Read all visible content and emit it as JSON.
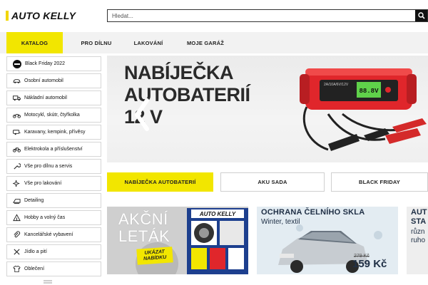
{
  "header": {
    "logo_text": "AUTO KELLY",
    "search_placeholder": "Hledat..."
  },
  "nav": {
    "items": [
      {
        "label": "KATALOG",
        "active": true
      },
      {
        "label": "PRO DÍLNU",
        "active": false
      },
      {
        "label": "LAKOVÁNÍ",
        "active": false
      },
      {
        "label": "MOJE GARÁŽ",
        "active": false
      }
    ]
  },
  "sidebar": {
    "items": [
      {
        "label": "Black Friday 2022",
        "icon": "black-friday-badge-icon"
      },
      {
        "label": "Osobní automobil",
        "icon": "car-icon"
      },
      {
        "label": "Nákladní automobil",
        "icon": "truck-icon"
      },
      {
        "label": "Motocykl, skútr, čtyřkolka",
        "icon": "motorcycle-icon"
      },
      {
        "label": "Karavany, kempink, přívěsy",
        "icon": "caravan-icon"
      },
      {
        "label": "Elektrokola a příslušenství",
        "icon": "ebike-icon"
      },
      {
        "label": "Vše pro dílnu a servis",
        "icon": "wrench-icon"
      },
      {
        "label": "Vše pro lakování",
        "icon": "sparkle-icon"
      },
      {
        "label": "Detailing",
        "icon": "detailing-icon"
      },
      {
        "label": "Hobby a volný čas",
        "icon": "tent-icon"
      },
      {
        "label": "Kancelářské vybavení",
        "icon": "paperclip-icon"
      },
      {
        "label": "Jídlo a pití",
        "icon": "cutlery-icon"
      },
      {
        "label": "Oblečení",
        "icon": "tshirt-icon"
      }
    ]
  },
  "banner": {
    "title": "NABÍJEČKA\nAUTOBATERIÍ\n12 V",
    "charger_display": "88.8V",
    "charger_brand": "2A/10A/6V/12V"
  },
  "banner_tabs": [
    {
      "label": "NABÍJEČKA AUTOBATERIÍ",
      "active": true
    },
    {
      "label": "AKU SADA",
      "active": false
    },
    {
      "label": "BLACK FRIDAY",
      "active": false
    }
  ],
  "promos": {
    "card1": {
      "title": "AKČNÍ\nLETÁK",
      "button_line1": "UKÁZAT",
      "button_line2": "NABÍDKU",
      "logo": "AUTO KELLY"
    },
    "card2": {
      "headline": "OCHRANA ČELNÍHO SKLA",
      "subline": "Winter, textil",
      "old_price": "279 Kč",
      "price": "159 Kč"
    },
    "card3": {
      "headline": "AUT\nSTA",
      "subline": "různ\nruho"
    }
  },
  "colors": {
    "accent_yellow": "#f2e600",
    "dark": "#111111",
    "red_charger": "#e0262b",
    "navy_text": "#203046"
  }
}
